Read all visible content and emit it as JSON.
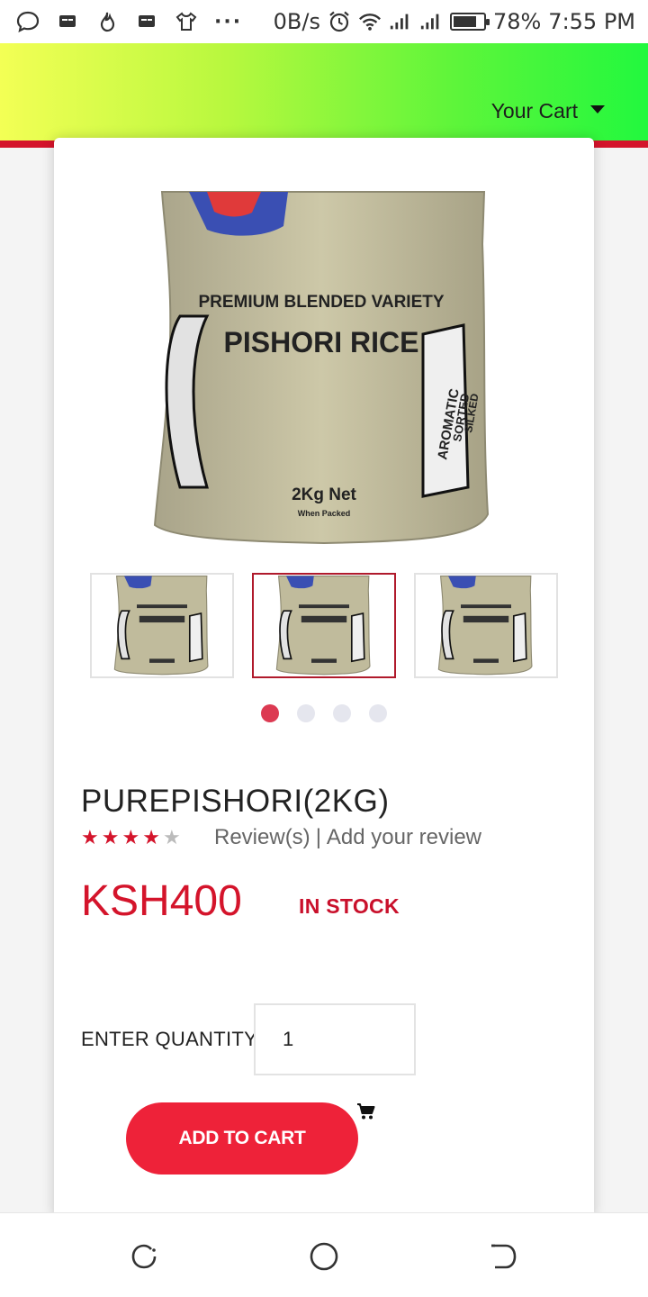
{
  "status_bar": {
    "speed": "0B/s",
    "battery_level": 0.78,
    "battery_text": "78%",
    "time": "7:55 PM",
    "icons": [
      "chat-bubble-icon",
      "message-icon",
      "flame-icon",
      "message-icon",
      "shirt-icon",
      "more-dots-icon",
      "alarm-icon",
      "wifi-icon",
      "signal-icon",
      "signal-icon",
      "battery-icon"
    ]
  },
  "header": {
    "cart_label": "Your Cart",
    "gradient_colors": [
      "#f3ff55",
      "#22f83e"
    ],
    "accent_color": "#d4142b"
  },
  "product": {
    "image_texts": {
      "line1": "PREMIUM BLENDED VARIETY",
      "line2": "PISHORI RICE",
      "side": "AROMATIC",
      "side2": "SORTED",
      "side3": "SILKED",
      "net": "2Kg Net",
      "packed": "When Packed"
    },
    "thumbnails_count": 3,
    "active_thumbnail": 1,
    "slide_count": 4,
    "active_slide": 0,
    "title": "PUREPISHORI(2KG)",
    "rating": 4,
    "rating_max": 5,
    "reviews_label": "Review(s)",
    "separator": "|",
    "add_review_label": "Add your review",
    "price": "KSH400",
    "stock_status": "IN STOCK",
    "quantity_label": "ENTER QUANTITY",
    "quantity_value": "1",
    "add_to_cart_label": "ADD TO CART",
    "price_color": "#d4142b",
    "button_color": "#ee2239"
  },
  "nav_bar": {
    "icons": [
      "recent-apps-icon",
      "home-icon",
      "back-icon"
    ]
  }
}
